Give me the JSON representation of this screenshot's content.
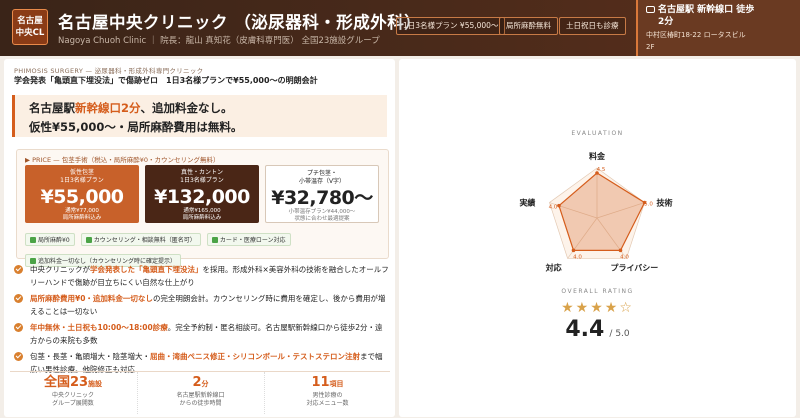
{
  "header": {
    "logo_line1": "名古屋",
    "logo_line2": "中央CL",
    "title": "名古屋中央クリニック （泌尿器科・形成外科）",
    "subtitle": "Nagoya Chuoh Clinic ｜ 院長：龍山 真知花（皮膚科専門医） 全国23施設グループ",
    "badges": [
      "1日3名様プラン ¥55,000〜",
      "局所麻酔無料",
      "土日祝日も診療"
    ],
    "access_title_1": "名古屋駅 新幹線口 徒歩",
    "access_title_2": "2分",
    "access_addr_1": "中村区椿町18-22 ロータスビル",
    "access_addr_2": "2F"
  },
  "article": {
    "breadcrumb": "PHIMOSIS SURGERY — 泌尿器科・形成外科専門クリニック",
    "lead": "学会発表「亀頭直下埋没法」で傷跡ゼロ　1日3名様プランで¥55,000〜の明朗会計",
    "headline_1a": "名古屋駅",
    "headline_1b": "新幹線口2分",
    "headline_1c": "、追加料金なし。",
    "headline_2": "仮性¥55,000〜・局所麻酔費用は無料。",
    "price_head": "▶ PRICE — 包茎手術（税込・局所麻酔¥0・カウンセリング無料）",
    "prices": [
      {
        "name1": "仮性包茎",
        "name2": "1日3名様プラン",
        "price": "¥55,000",
        "d1": "通常¥77,000",
        "d2": "局所麻酔料込み"
      },
      {
        "name1": "真性・カントン",
        "name2": "1日3名様プラン",
        "price": "¥132,000",
        "d1": "通常¥165,000",
        "d2": "局所麻酔料込み"
      },
      {
        "name1": "プチ包茎・",
        "name2": "小帯温存（V字）",
        "price": "¥32,780〜",
        "d1": "小帯温存プラン¥44,000〜",
        "d2": "状態に合わせ最適提案"
      }
    ],
    "chips": [
      "局所麻酔¥0",
      "カウンセリング・相談無料（匿名可）",
      "カード・医療ローン対応",
      "追加料金一切なし（カウンセリング時に確定提示）"
    ],
    "bullets": [
      {
        "a": "中央クリニックが",
        "b": "学会発表した「亀頭直下埋没法」",
        "c": "を採用。形成外科×美容外科の技術を融合したオールフリーハンドで傷跡が目立ちにくい自然な仕上がり"
      },
      {
        "a": "",
        "b": "局所麻酔費用¥0・追加料金一切なし",
        "c": "の完全明朗会計。カウンセリング時に費用を確定し、後から費用が増えることは一切ない"
      },
      {
        "a": "",
        "b": "年中無休・土日祝も10:00〜18:00診療",
        "c": "。完全予約制・匿名相談可。名古屋駅新幹線口から徒歩2分・遠方からの来院も多数"
      },
      {
        "a": "包茎・長茎・亀頭増大・陰茎増大・",
        "b": "屈曲・湾曲ペニス修正・シリコンボール・テストステロン注射",
        "c": "まで幅広い男性診療。他院修正も対応"
      }
    ],
    "stats": [
      {
        "big": "全国23",
        "unit": "施設",
        "c1": "中央クリニック",
        "c2": "グループ展開数"
      },
      {
        "big": "2",
        "unit": "分",
        "c1": "名古屋駅新幹線口",
        "c2": "からの徒歩時間"
      },
      {
        "big": "11",
        "unit": "項目",
        "c1": "男性診療の",
        "c2": "対応メニュー数"
      }
    ]
  },
  "evaluation": {
    "title": "EVALUATION",
    "overall_title": "OVERALL RATING",
    "stars": "★★★★☆",
    "score": "4.4",
    "score_max": "/ 5.0",
    "axes": [
      "料金",
      "技術",
      "プライバシー",
      "対応",
      "実績"
    ],
    "values": [
      4.5,
      5.0,
      4.0,
      4.0,
      4.0
    ],
    "value_labels": [
      "4.5",
      "5.0",
      "4.0",
      "4.0",
      "4.0"
    ],
    "max": 5
  },
  "colors": {
    "accent": "#d55d1c",
    "dark": "#3a2418"
  }
}
